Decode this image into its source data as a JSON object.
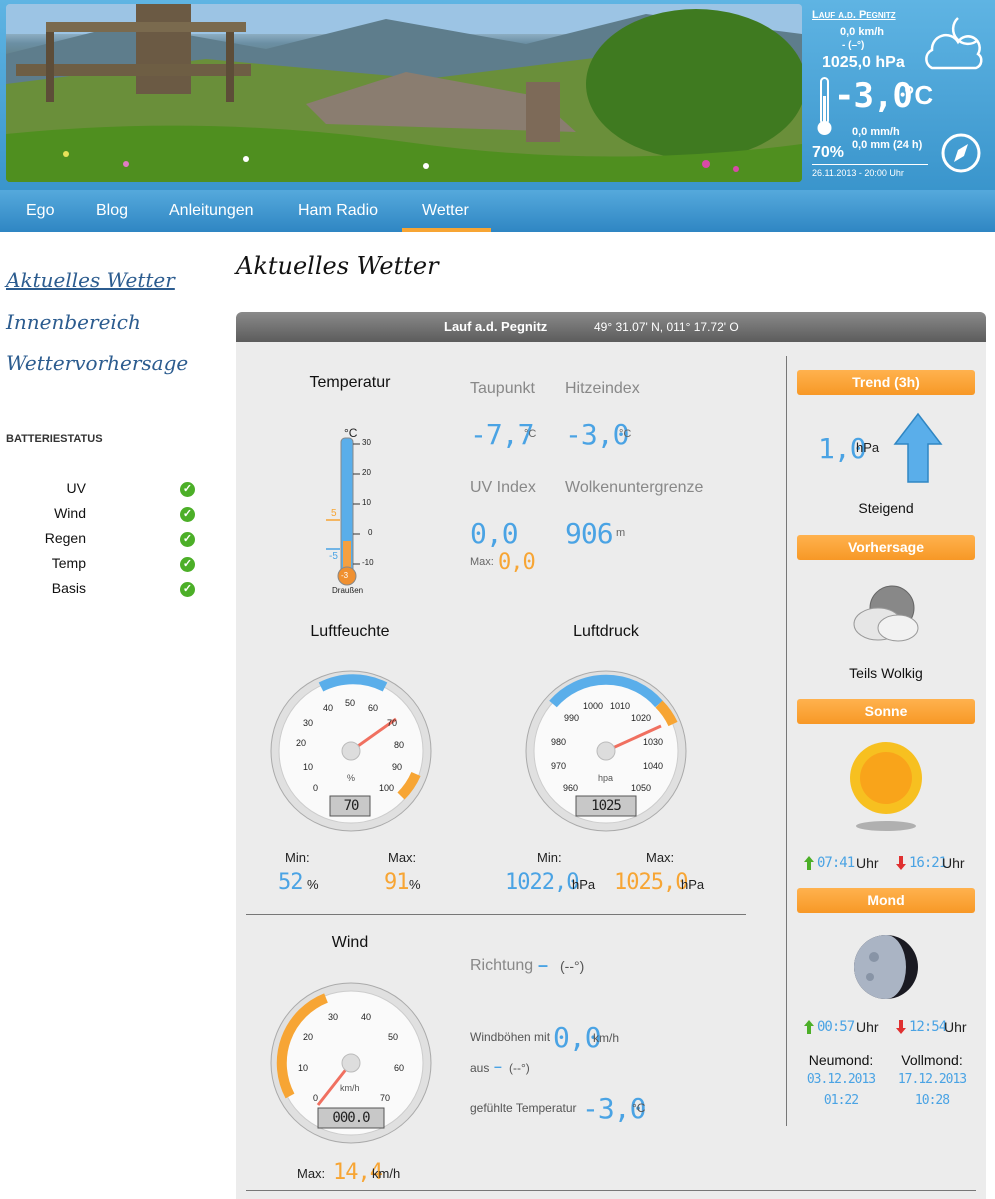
{
  "header": {
    "location": "Lauf a.d. Pegnitz",
    "wind": "0,0 km/h",
    "wind_dir": "- (–°)",
    "pressure": "1025,0 hPa",
    "temperature": "-3,0",
    "temp_unit": "°C",
    "rain_rate": "0,0 mm/h",
    "rain_24h": "0,0 mm (24 h)",
    "humidity": "70%",
    "datetime": "26.11.2013 - 20:00 Uhr"
  },
  "nav": {
    "items": [
      "Ego",
      "Blog",
      "Anleitungen",
      "Ham Radio",
      "Wetter"
    ],
    "active": "Wetter"
  },
  "sidebar": {
    "links": [
      "Aktuelles Wetter",
      "Innenbereich",
      "Wettervorhersage"
    ],
    "battery_title": "BATTERIESTATUS",
    "battery": [
      "UV",
      "Wind",
      "Regen",
      "Temp",
      "Basis"
    ],
    "check_icon": "check-icon"
  },
  "page": {
    "title": "Aktuelles Wetter"
  },
  "panel": {
    "location": "Lauf a.d. Pegnitz",
    "coords": "49° 31.07' N, 011° 17.72' O",
    "temperature": {
      "title": "Temperatur",
      "unit": "°C",
      "scale": [
        "30",
        "20",
        "10",
        "0",
        "-10"
      ],
      "value": "-3",
      "label": "Draußen",
      "marker_hi": "5",
      "marker_lo": "-5"
    },
    "dewpoint": {
      "label": "Taupunkt",
      "value": "-7,7",
      "unit": "°C"
    },
    "heatindex": {
      "label": "Hitzeindex",
      "value": "-3,0",
      "unit": "°C"
    },
    "uv": {
      "label": "UV Index",
      "value": "0,0",
      "max_label": "Max:",
      "max_value": "0,0"
    },
    "cloudbase": {
      "label": "Wolkenuntergrenze",
      "value": "906",
      "unit": "m"
    },
    "humidity": {
      "title": "Luftfeuchte",
      "unit": "%",
      "value": "70",
      "ticks": [
        "0",
        "10",
        "20",
        "30",
        "40",
        "50",
        "60",
        "70",
        "80",
        "90",
        "100"
      ],
      "min_label": "Min:",
      "min_value": "52",
      "max_label": "Max:",
      "max_value": "91",
      "value_unit": "%"
    },
    "pressure": {
      "title": "Luftdruck",
      "unit": "hpa",
      "value": "1025",
      "ticks": [
        "960",
        "970",
        "980",
        "990",
        "1000",
        "1010",
        "1020",
        "1030",
        "1040",
        "1050"
      ],
      "min_label": "Min:",
      "min_value": "1022,0",
      "max_label": "Max:",
      "max_value": "1025,0",
      "value_unit": "hPa"
    },
    "wind": {
      "title": "Wind",
      "unit": "km/h",
      "value": "000.0",
      "ticks": [
        "0",
        "10",
        "20",
        "30",
        "40",
        "50",
        "60",
        "70"
      ],
      "max_label": "Max:",
      "max_value": "14,4",
      "max_unit": "km/h",
      "direction_label": "Richtung",
      "direction_value": "–",
      "direction_deg": "(--°)",
      "gust_label": "Windböhen mit",
      "gust_value": "0,0",
      "gust_unit": "km/h",
      "from_label": "aus",
      "from_value": "–",
      "from_deg": "(--°)",
      "feels_label": "gefühlte Temperatur",
      "feels_value": "-3,0",
      "feels_unit": "°C"
    },
    "trend": {
      "title": "Trend (3h)",
      "value": "1,0",
      "unit": "hPa",
      "text": "Steigend",
      "arrow_icon": "arrow-up-icon"
    },
    "forecast": {
      "title": "Vorhersage",
      "text": "Teils Wolkig",
      "icon": "cloud-icon"
    },
    "sun": {
      "title": "Sonne",
      "rise": "07:41",
      "set": "16:21",
      "unit": "Uhr",
      "icon": "sun-icon"
    },
    "moon": {
      "title": "Mond",
      "rise": "00:57",
      "set": "12:54",
      "unit": "Uhr",
      "new_label": "Neumond:",
      "new_date": "03.12.2013",
      "new_time": "01:22",
      "full_label": "Vollmond:",
      "full_date": "17.12.2013",
      "full_time": "10:28",
      "icon": "moon-icon"
    }
  },
  "colors": {
    "accent": "#3a95cc",
    "blue": "#4aa3e4",
    "orange": "#f7a534",
    "green": "#4caf28"
  }
}
